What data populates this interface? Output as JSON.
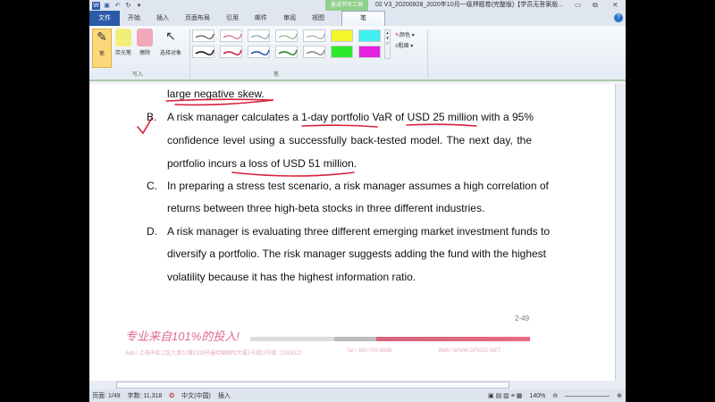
{
  "titlebar": {
    "context_tab": "墨迹书写工具",
    "title": "02 V3_20200928_2020年10月一级押题卷(完整版)【学员无答案版...",
    "min": "▭",
    "max": "⧉",
    "close": "✕"
  },
  "tabs": [
    "文件",
    "开始",
    "插入",
    "页面布局",
    "引用",
    "邮件",
    "审阅",
    "视图",
    "笔"
  ],
  "ribbon": {
    "tools": [
      "笔",
      "荧光笔",
      "擦除",
      "选择对象"
    ],
    "group_write": "写入",
    "group_pen": "笔",
    "color_label": "颜色",
    "weight_label": "粗细"
  },
  "document": {
    "lines": [
      "large negative skew.",
      "A risk manager calculates a 1-day portfolio VaR of USD 25 million with a 95%",
      "confidence level using a successfully back-tested model. The next day, the",
      "portfolio incurs a loss of USD 51 million.",
      "In preparing a stress test scenario, a risk manager assumes a high correlation of",
      "returns between three high-beta stocks in three different industries.",
      "A risk manager is evaluating three different emerging market investment funds to",
      "diversify a portfolio. The risk manager suggests adding the fund with the highest",
      "volatility because it has the highest information ratio."
    ],
    "bullets": [
      "B.",
      "C.",
      "D."
    ],
    "page_label": "2-49",
    "slogan": "专业来自101%的投入!",
    "address": "Add / 上海市松江区九新公路2339号曼哈顿国际大厦1号楼/2号楼（201612）",
    "tel": "Tel / 400-700-9596",
    "web": "Web / WWW.GFEDU.NET"
  },
  "status": {
    "page": "页面: 1/49",
    "words": "字数: 11,318",
    "lang": "中文(中国)",
    "mode": "插入",
    "zoom": "140%"
  }
}
